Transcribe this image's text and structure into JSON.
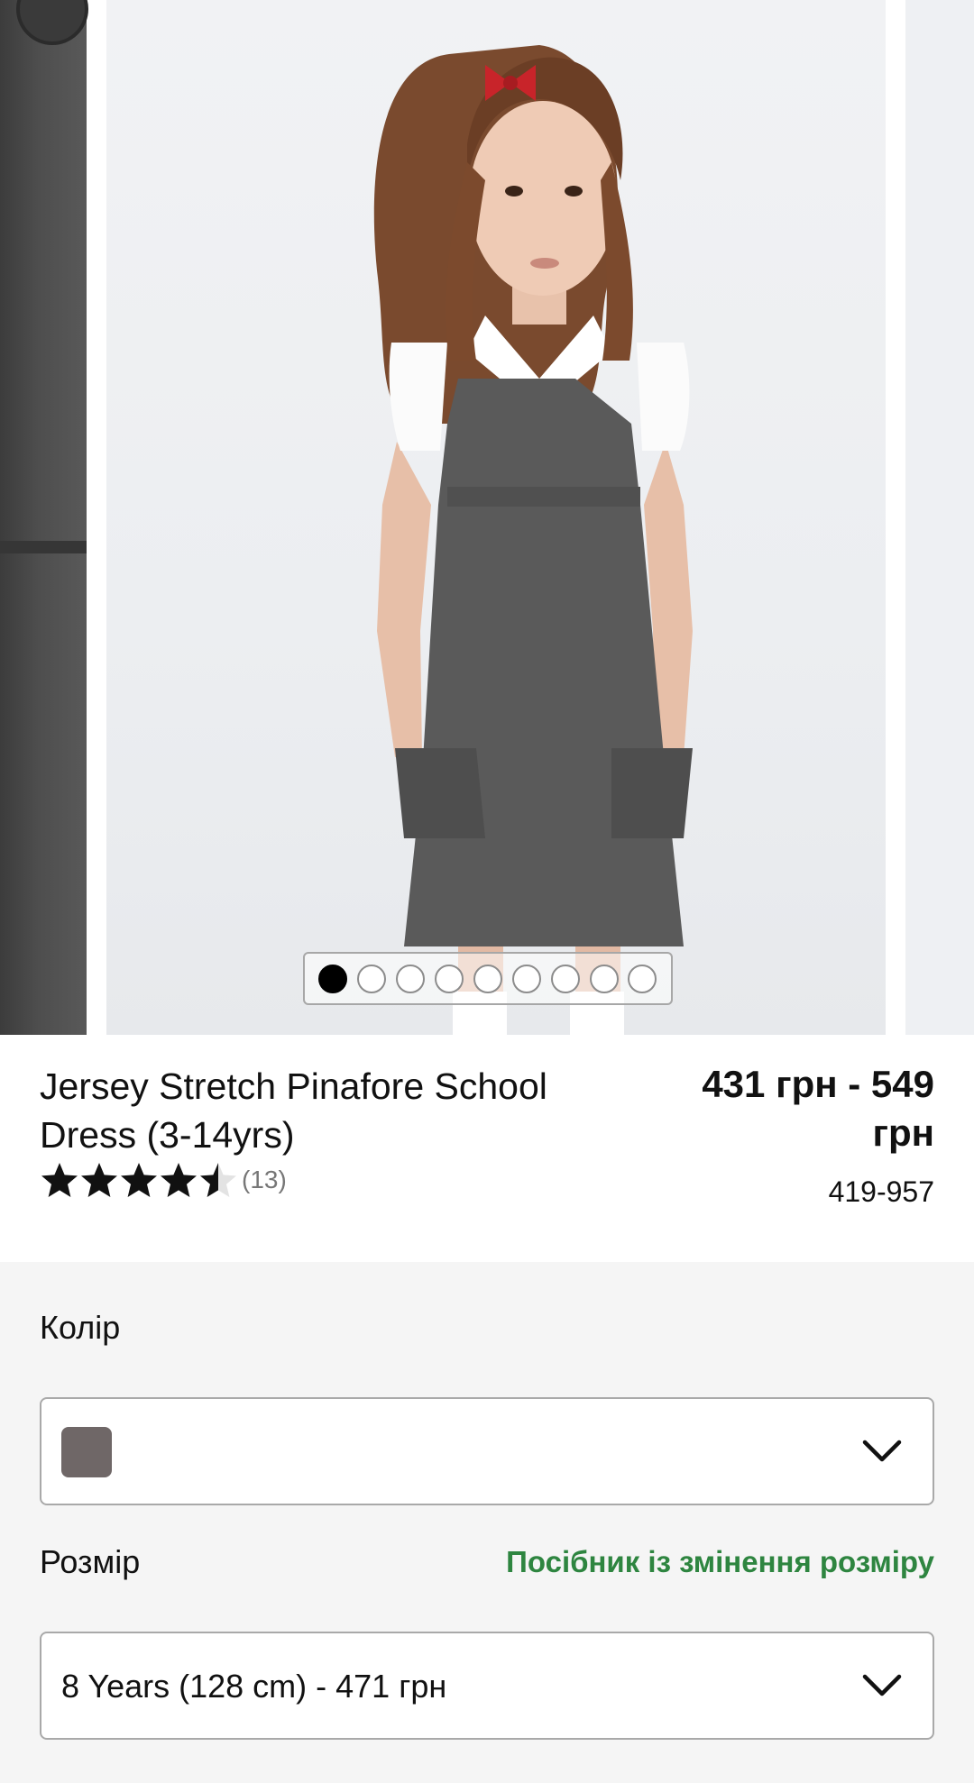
{
  "product": {
    "title": "Jersey Stretch Pinafore School Dress (3-14yrs)",
    "price": "431 грн - 549 грн",
    "sku": "419-957",
    "rating": 4.5,
    "review_count": "(13)"
  },
  "carousel": {
    "slide_count": 9,
    "active_index": 0
  },
  "color": {
    "label": "Колір",
    "selected_swatch": "#6f6767"
  },
  "size": {
    "label": "Розмір",
    "guide_link": "Посібник із змінення розміру",
    "selected": "8 Years (128 cm) - 471 грн"
  },
  "colors": {
    "link_green": "#2e8540",
    "text": "#111111"
  },
  "icons": {
    "select_arrow": "chevron-down-icon",
    "rating": "star-icon"
  }
}
